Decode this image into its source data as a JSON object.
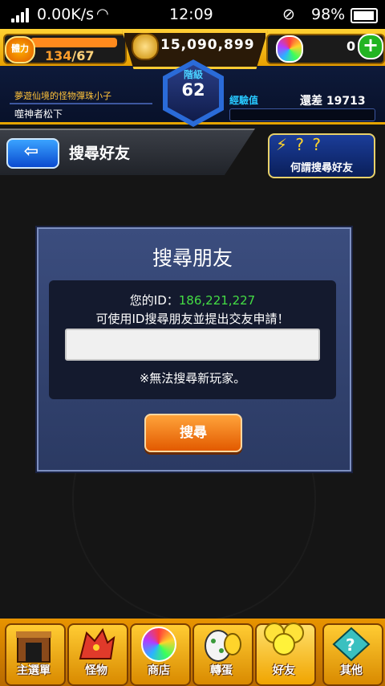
{
  "status_bar": {
    "speed": "0.00K/s",
    "time": "12:09",
    "battery": "98%"
  },
  "hud": {
    "stamina_label": "體力",
    "stamina_current": "134",
    "stamina_max": "/67",
    "gold": "15,090,899",
    "orbs": "0",
    "rank_label": "階級",
    "rank": "62",
    "player_title": "夢遊仙境的怪物彈珠小子",
    "player_name": "噬神者松下",
    "exp_label": "經驗值",
    "exp_remaining": "還差 19713"
  },
  "header": {
    "title": "搜尋好友",
    "help_label": "何謂搜尋好友",
    "help_icons": "⚡ ? ?"
  },
  "dialog": {
    "title": "搜尋朋友",
    "id_prefix": "您的ID：",
    "id_value": "186,221,227",
    "description": "可使用ID搜尋朋友並提出交友申請！",
    "input_value": "",
    "note": "※無法搜尋新玩家。",
    "search_button": "搜尋"
  },
  "nav": {
    "tabs": [
      {
        "label": "主選單",
        "icon": "castle-gate-icon"
      },
      {
        "label": "怪物",
        "icon": "dragon-icon"
      },
      {
        "label": "商店",
        "icon": "rainbow-orb-icon"
      },
      {
        "label": "轉蛋",
        "icon": "egg-icon"
      },
      {
        "label": "好友",
        "icon": "friends-balloon-icon"
      },
      {
        "label": "其他",
        "icon": "misc-icon"
      }
    ]
  },
  "colors": {
    "accent_gold": "#ffcb33",
    "id_green": "#44dd44",
    "button_orange": "#ff8a1d",
    "dialog_blue": "#34456f"
  }
}
